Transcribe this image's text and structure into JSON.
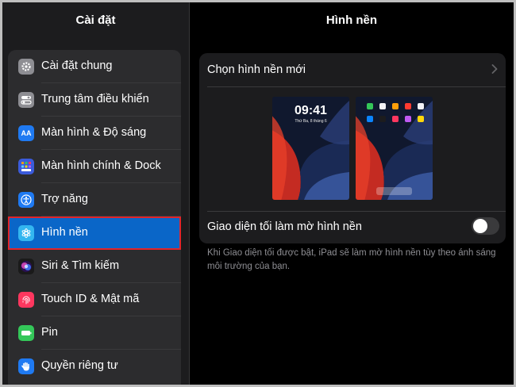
{
  "sidebar": {
    "title": "Cài đặt",
    "items": [
      {
        "label": "Cài đặt chung",
        "icon": "gear-icon",
        "color": "#8e8e93"
      },
      {
        "label": "Trung tâm điều khiển",
        "icon": "toggles-icon",
        "color": "#8e8e93"
      },
      {
        "label": "Màn hình & Độ sáng",
        "icon": "text-size-icon",
        "color": "#1f7af2",
        "glyph": "AA"
      },
      {
        "label": "Màn hình chính & Dock",
        "icon": "app-grid-icon",
        "color": "#3b5bdb"
      },
      {
        "label": "Trợ năng",
        "icon": "accessibility-icon",
        "color": "#1f7af2"
      },
      {
        "label": "Hình nền",
        "icon": "flower-icon",
        "color": "#33b6f0",
        "selected": true
      },
      {
        "label": "Siri & Tìm kiếm",
        "icon": "siri-icon",
        "color": "#1a1a1a"
      },
      {
        "label": "Touch ID & Mật mã",
        "icon": "fingerprint-icon",
        "color": "#ff375f"
      },
      {
        "label": "Pin",
        "icon": "battery-icon",
        "color": "#34c759"
      },
      {
        "label": "Quyền riêng tư",
        "icon": "hand-icon",
        "color": "#1f7af2"
      }
    ]
  },
  "detail": {
    "title": "Hình nền",
    "choose_label": "Chọn hình nền mới",
    "lock_preview": {
      "time": "09:41",
      "date": "Thứ Ba, 8 tháng 6"
    },
    "dark_dims_label": "Giao diện tối làm mờ hình nền",
    "dark_dims_on": false,
    "footer_note": "Khi Giao diện tối được bật, iPad sẽ làm mờ hình nền tùy theo ánh sáng môi trường của bạn."
  },
  "colors": {
    "accent": "#0a66c8",
    "highlight_border": "#e1252b"
  }
}
